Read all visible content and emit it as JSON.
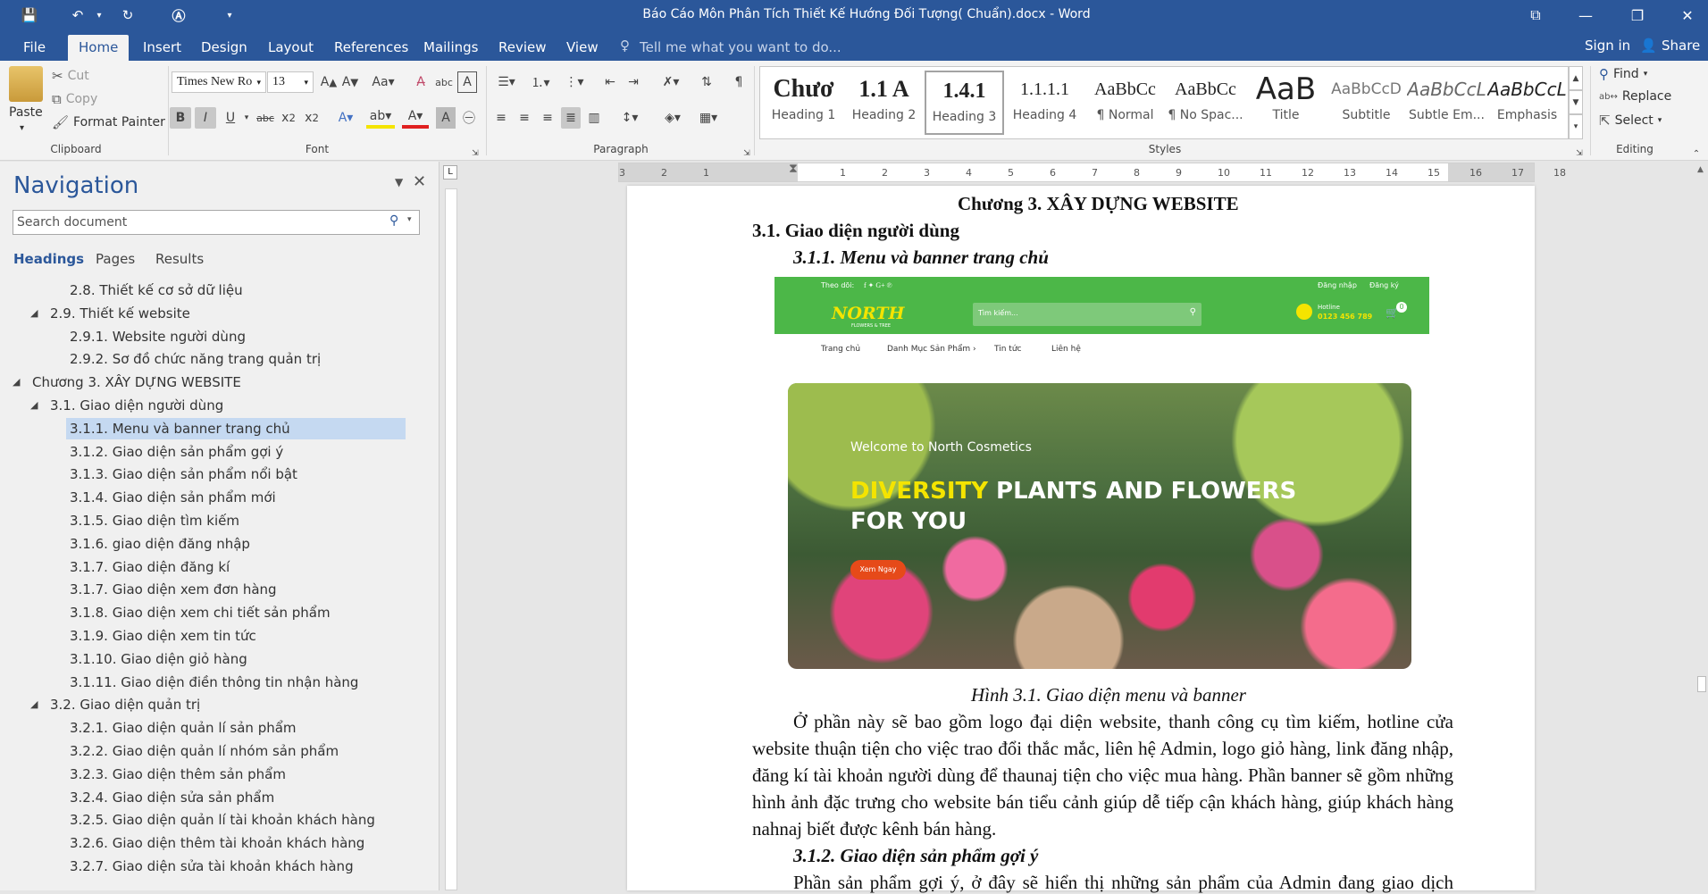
{
  "titlebar": {
    "doc_title": "Báo Cáo Môn Phân Tích Thiết Kế Hướng Đối Tượng( Chuẩn).docx - Word",
    "color": "#2b579a"
  },
  "menu": {
    "tabs": [
      "File",
      "Home",
      "Insert",
      "Design",
      "Layout",
      "References",
      "Mailings",
      "Review",
      "View"
    ],
    "active": "Home",
    "tell_me": "Tell me what you want to do...",
    "sign_in": "Sign in",
    "share": "Share"
  },
  "clipboard": {
    "paste": "Paste",
    "cut": "Cut",
    "copy": "Copy",
    "format_painter": "Format Painter",
    "label": "Clipboard"
  },
  "font": {
    "name": "Times New Ro",
    "size": "13",
    "label": "Font"
  },
  "paragraph": {
    "label": "Paragraph"
  },
  "styles": {
    "label": "Styles",
    "items": [
      {
        "preview": "Chươ",
        "name": "Heading 1"
      },
      {
        "preview": "1.1  A",
        "name": "Heading 2"
      },
      {
        "preview": "1.4.1",
        "name": "Heading 3"
      },
      {
        "preview": "1.1.1.1",
        "name": "Heading 4"
      },
      {
        "preview": "AaBbCc",
        "name": "¶ Normal"
      },
      {
        "preview": "AaBbCc",
        "name": "¶ No Spac..."
      },
      {
        "preview": "AaB",
        "name": "Title"
      },
      {
        "preview": "AaBbCcD",
        "name": "Subtitle"
      },
      {
        "preview": "AaBbCcL",
        "name": "Subtle Em..."
      },
      {
        "preview": "AaBbCcL",
        "name": "Emphasis"
      }
    ]
  },
  "editing": {
    "find": "Find",
    "replace": "Replace",
    "select": "Select",
    "label": "Editing"
  },
  "navigation": {
    "title": "Navigation",
    "search_placeholder": "Search document",
    "tabs": [
      "Headings",
      "Pages",
      "Results"
    ],
    "items": [
      {
        "text": "2.8. Thiết kế cơ sở dữ liệu",
        "level": 3
      },
      {
        "text": "2.9. Thiết kế website",
        "level": 2,
        "toggle": true
      },
      {
        "text": "2.9.1. Website người dùng",
        "level": 3
      },
      {
        "text": "2.9.2. Sơ đồ chức năng trang quản trị",
        "level": 3
      },
      {
        "text": "Chương 3. XÂY DỰNG WEBSITE",
        "level": 1,
        "toggle": true
      },
      {
        "text": "3.1. Giao diện người dùng",
        "level": 2,
        "toggle": true
      },
      {
        "text": "3.1.1. Menu và banner trang chủ",
        "level": 3,
        "selected": true
      },
      {
        "text": "3.1.2. Giao diện sản phẩm gợi ý",
        "level": 3
      },
      {
        "text": "3.1.3. Giao diện sản phẩm nổi bật",
        "level": 3
      },
      {
        "text": "3.1.4. Giao diện sản phẩm mới",
        "level": 3
      },
      {
        "text": "3.1.5. Giao diện tìm kiếm",
        "level": 3
      },
      {
        "text": "3.1.6. giao diện đăng nhập",
        "level": 3
      },
      {
        "text": "3.1.7. Giao diện đăng kí",
        "level": 3
      },
      {
        "text": "3.1.7. Giao diện xem đơn hàng",
        "level": 3
      },
      {
        "text": "3.1.8. Giao diện xem chi tiết sản phẩm",
        "level": 3
      },
      {
        "text": "3.1.9. Giao diện xem tin tức",
        "level": 3
      },
      {
        "text": "3.1.10. Giao diện giỏ hàng",
        "level": 3
      },
      {
        "text": "3.1.11. Giao diện điền thông tin nhận hàng",
        "level": 3
      },
      {
        "text": "3.2. Giao diện quản trị",
        "level": 2,
        "toggle": true
      },
      {
        "text": "3.2.1. Giao diện quản lí sản phẩm",
        "level": 3
      },
      {
        "text": "3.2.2. Giao diện quản lí nhóm sản phẩm",
        "level": 3
      },
      {
        "text": "3.2.3. Giao diện thêm sản phẩm",
        "level": 3
      },
      {
        "text": "3.2.4. Giao diện sửa sản phẩm",
        "level": 3
      },
      {
        "text": " 3.2.5. Giao diện quản lí tài khoản khách hàng",
        "level": 3
      },
      {
        "text": "3.2.6. Giao diện thêm tài khoản khách hàng",
        "level": 3
      },
      {
        "text": "3.2.7. Giao diện sửa tài khoản khách hàng",
        "level": 3
      }
    ]
  },
  "ruler": {
    "h_ticks": [
      "3",
      "2",
      "1",
      "1",
      "2",
      "3",
      "4",
      "5",
      "6",
      "7",
      "8",
      "9",
      "10",
      "11",
      "12",
      "13",
      "14",
      "15",
      "16",
      "17",
      "18"
    ]
  },
  "document": {
    "chapter": "Chương 3. XÂY DỰNG WEBSITE",
    "h2": "3.1. Giao diện người dùng",
    "h3": "3.1.1. Menu và banner trang chủ",
    "caption": "Hình 3.1. Giao diện menu và banner",
    "para": [
      "Ở phần này sẽ bao gồm logo đại diện website, thanh công cụ tìm kiếm, hotline cửa",
      "website thuận tiện cho việc trao đổi thắc mắc, liên hệ Admin, logo giỏ hàng, link đăng nhập,",
      "đăng kí tài khoản người dùng để thaunaj tiện cho việc mua hàng. Phần banner sẽ gồm những",
      "hình ảnh đặc trưng cho website bán tiểu cảnh giúp dễ tiếp cận khách hàng, giúp khách hàng",
      "nahnaj biết được kênh bán hàng."
    ],
    "h3b": "3.1.2. Giao diện sản phẩm gợi ý",
    "para2": "Phần sản phẩm gợi ý, ở đây sẽ hiển thị những sản phẩm của Admin đang giao dịch"
  },
  "site": {
    "follow": "Theo dõi:",
    "login": "Đăng nhập",
    "register": "Đăng ký",
    "logo": "NORTH",
    "logo_sub": "FLOWERS & TREE",
    "search_placeholder": "Tìm kiếm...",
    "hotline_label": "Hotline",
    "hotline": "0123 456 789",
    "cart_count": "0",
    "nav": [
      "Trang chủ",
      "Danh Mục Sản Phẩm ›",
      "Tin tức",
      "Liên hệ"
    ],
    "welcome": "Welcome to North Cosmetics",
    "headline_accent": "DIVERSITY",
    "headline_rest": " PLANTS AND FLOWERS",
    "headline_line2": "FOR YOU",
    "cta": "Xem Ngay",
    "green": "#4cb748",
    "accent_yellow": "#f4e400",
    "cta_color": "#e64a19"
  }
}
